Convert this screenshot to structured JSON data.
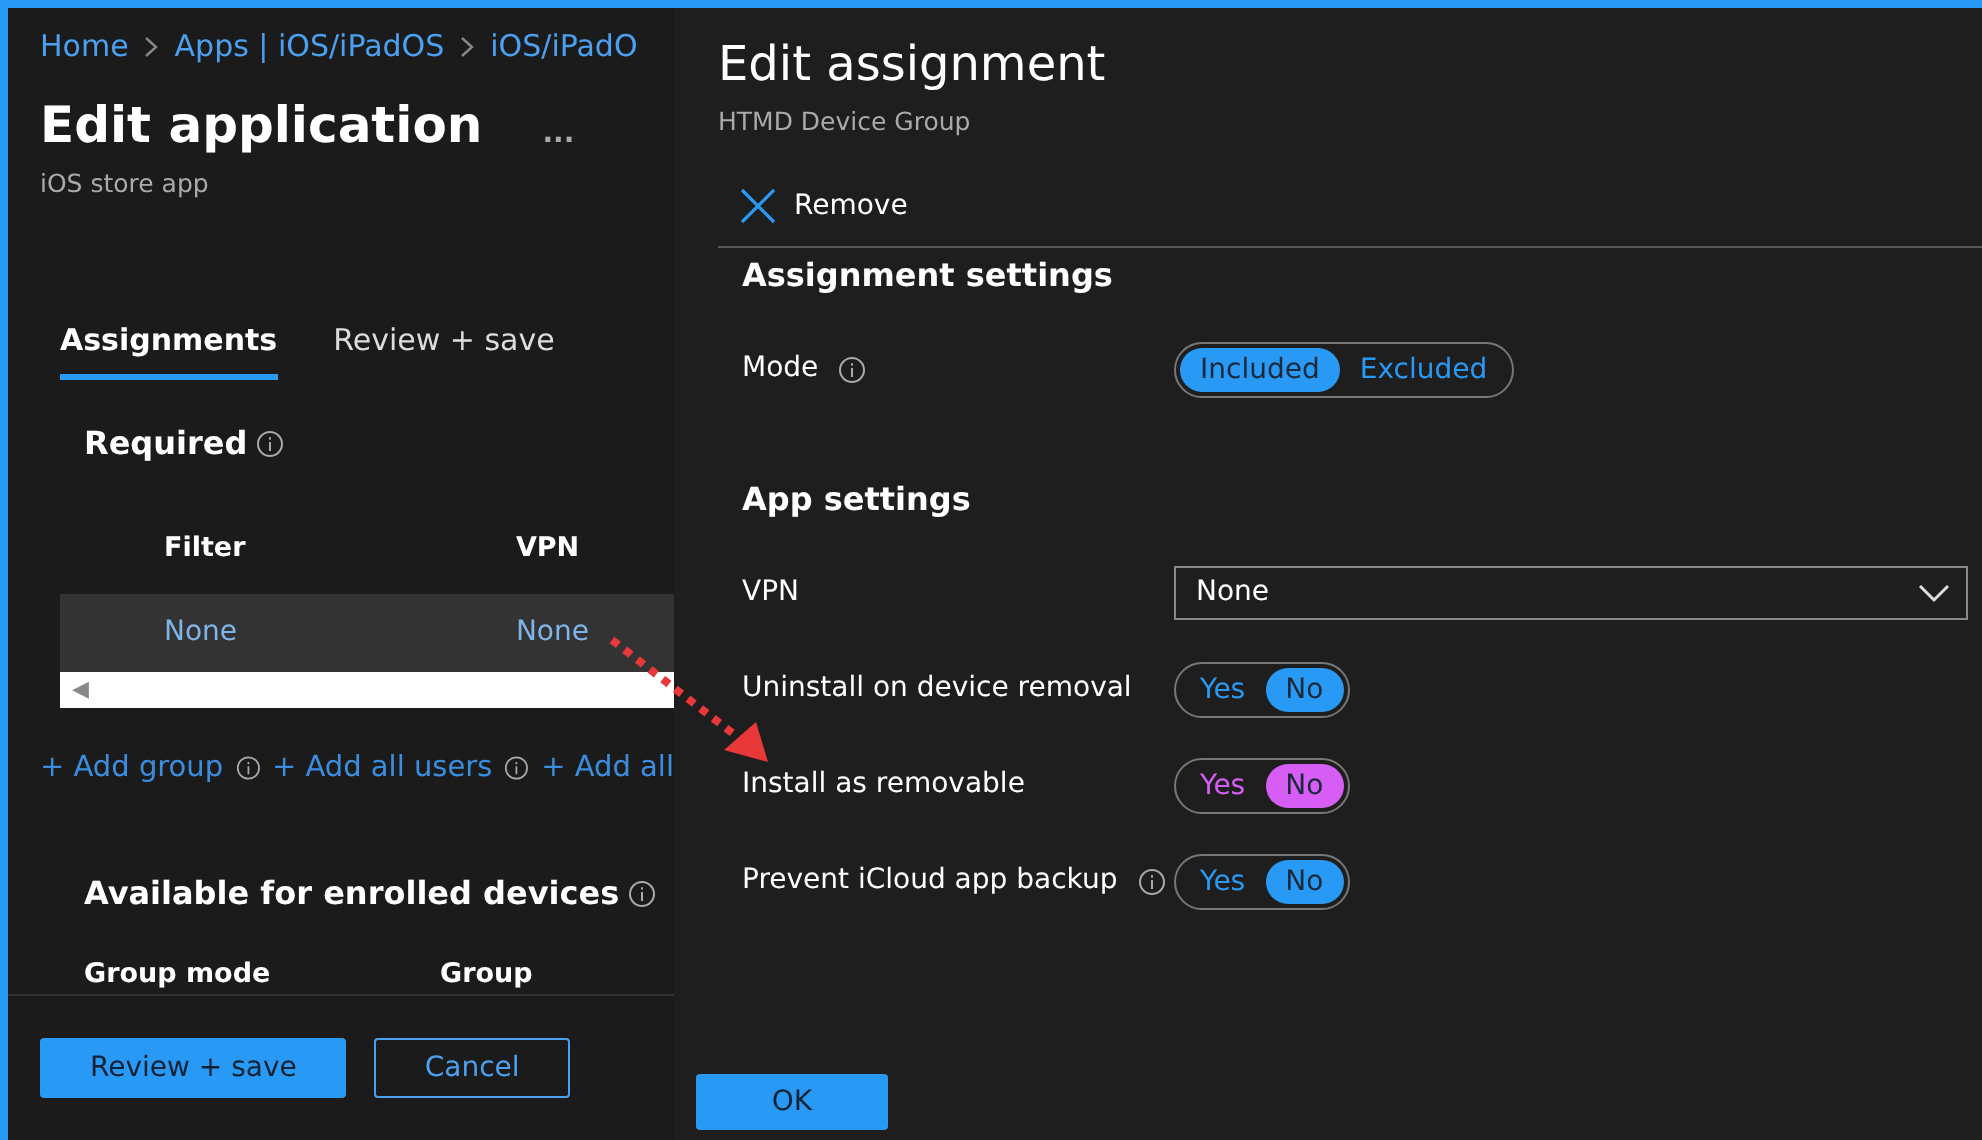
{
  "breadcrumb": [
    "Home",
    "Apps | iOS/iPadOS",
    "iOS/iPadO"
  ],
  "page": {
    "title": "Edit application",
    "more": "...",
    "subtitle": "iOS store app"
  },
  "tabs": [
    {
      "label": "Assignments",
      "selected": true
    },
    {
      "label": "Review + save",
      "selected": false
    }
  ],
  "required": {
    "title": "Required",
    "columns": [
      "Filter",
      "VPN"
    ],
    "rows": [
      [
        "None",
        "None"
      ]
    ],
    "scroll_arrow": "◀"
  },
  "add_links": [
    {
      "label": "+ Add group",
      "info": true
    },
    {
      "label": "+ Add all users",
      "info": true
    },
    {
      "label": "+ Add all",
      "info": false
    }
  ],
  "available": {
    "title": "Available for enrolled devices",
    "columns": [
      "Group mode",
      "Group"
    ]
  },
  "footer_buttons": [
    {
      "label": "Review + save",
      "kind": "primary"
    },
    {
      "label": "Cancel",
      "kind": "outline"
    }
  ],
  "panel": {
    "title": "Edit assignment",
    "subtitle": "HTMD Device Group",
    "remove": "Remove",
    "assignment_settings": {
      "title": "Assignment settings",
      "mode_label": "Mode",
      "options": [
        {
          "label": "Included",
          "selected": true
        },
        {
          "label": "Excluded",
          "selected": false
        }
      ]
    },
    "app_settings": {
      "title": "App settings",
      "vpn_label": "VPN",
      "vpn_value": "None",
      "toggles": [
        {
          "label": "Uninstall on device removal",
          "info": false,
          "color": "#2899f5",
          "options": [
            {
              "label": "Yes",
              "selected": false
            },
            {
              "label": "No",
              "selected": true
            }
          ]
        },
        {
          "label": "Install as removable",
          "info": false,
          "color": "#d65ef5",
          "options": [
            {
              "label": "Yes",
              "selected": false
            },
            {
              "label": "No",
              "selected": true
            }
          ]
        },
        {
          "label": "Prevent iCloud app backup",
          "info": true,
          "color": "#2899f5",
          "options": [
            {
              "label": "Yes",
              "selected": false
            },
            {
              "label": "No",
              "selected": true
            }
          ]
        }
      ]
    },
    "ok": "OK"
  }
}
